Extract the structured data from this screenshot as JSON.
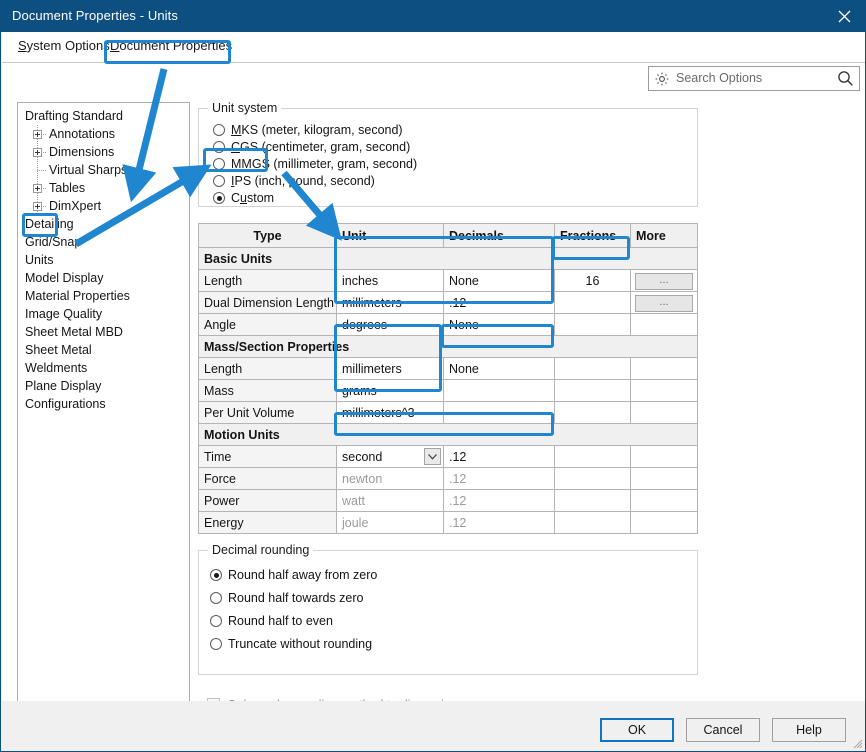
{
  "window": {
    "title": "Document Properties - Units",
    "close_icon": "close-icon",
    "titlebar_color": "#0d4f80"
  },
  "tabs": [
    {
      "label": "System Options",
      "mnemonic": "S",
      "selected": false
    },
    {
      "label": "Document Properties",
      "mnemonic": "D",
      "selected": true
    }
  ],
  "search": {
    "placeholder": "Search Options",
    "gear_icon": "gear-icon",
    "magnifier_icon": "search-icon"
  },
  "tree": {
    "items": [
      {
        "label": "Drafting Standard",
        "level": 0,
        "expandable": false,
        "selected": false
      },
      {
        "label": "Annotations",
        "level": 1,
        "expandable": true,
        "selected": false
      },
      {
        "label": "Dimensions",
        "level": 1,
        "expandable": true,
        "selected": false
      },
      {
        "label": "Virtual Sharps",
        "level": 1,
        "expandable": false,
        "selected": false
      },
      {
        "label": "Tables",
        "level": 1,
        "expandable": true,
        "selected": false
      },
      {
        "label": "DimXpert",
        "level": 1,
        "expandable": true,
        "selected": false
      },
      {
        "label": "Detailing",
        "level": 0,
        "expandable": false,
        "selected": false
      },
      {
        "label": "Grid/Snap",
        "level": 0,
        "expandable": false,
        "selected": false
      },
      {
        "label": "Units",
        "level": 0,
        "expandable": false,
        "selected": true
      },
      {
        "label": "Model Display",
        "level": 0,
        "expandable": false,
        "selected": false
      },
      {
        "label": "Material Properties",
        "level": 0,
        "expandable": false,
        "selected": false
      },
      {
        "label": "Image Quality",
        "level": 0,
        "expandable": false,
        "selected": false
      },
      {
        "label": "Sheet Metal MBD",
        "level": 0,
        "expandable": false,
        "selected": false
      },
      {
        "label": "Sheet Metal",
        "level": 0,
        "expandable": false,
        "selected": false
      },
      {
        "label": "Weldments",
        "level": 0,
        "expandable": false,
        "selected": false
      },
      {
        "label": "Plane Display",
        "level": 0,
        "expandable": false,
        "selected": false
      },
      {
        "label": "Configurations",
        "level": 0,
        "expandable": false,
        "selected": false
      }
    ]
  },
  "unit_system": {
    "legend": "Unit system",
    "options": [
      {
        "label": "MKS  (meter, kilogram, second)",
        "mnemonic": "M",
        "selected": false
      },
      {
        "label": "CGS  (centimeter, gram, second)",
        "mnemonic": "C",
        "selected": false
      },
      {
        "label": "MMGS (millimeter, gram, second)",
        "mnemonic": "G",
        "selected": false
      },
      {
        "label": "IPS  (inch, pound, second)",
        "mnemonic": "I",
        "selected": false
      },
      {
        "label": "Custom",
        "mnemonic": "u",
        "selected": true
      }
    ]
  },
  "units_table": {
    "headers": [
      "Type",
      "Unit",
      "Decimals",
      "Fractions",
      "More"
    ],
    "rows": [
      {
        "kind": "section",
        "type": "Basic Units"
      },
      {
        "kind": "data",
        "type": "Length",
        "unit": "inches",
        "decimals": "None",
        "fractions": "16",
        "more": "...",
        "dimmed": false
      },
      {
        "kind": "data",
        "type": "Dual Dimension Length",
        "unit": "millimeters",
        "decimals": ".12",
        "fractions": "",
        "more": "...",
        "dimmed": false
      },
      {
        "kind": "data",
        "type": "Angle",
        "unit": "degrees",
        "decimals": "None",
        "fractions": "",
        "more": "",
        "dimmed": false
      },
      {
        "kind": "section",
        "type": "Mass/Section Properties"
      },
      {
        "kind": "data",
        "type": "Length",
        "unit": "millimeters",
        "decimals": "None",
        "fractions": "",
        "more": "",
        "dimmed": false
      },
      {
        "kind": "data",
        "type": "Mass",
        "unit": "grams",
        "decimals": "",
        "fractions": "",
        "more": "",
        "dimmed": false
      },
      {
        "kind": "data",
        "type": "Per Unit Volume",
        "unit": "millimeters^3",
        "decimals": "",
        "fractions": "",
        "more": "",
        "dimmed": false
      },
      {
        "kind": "section",
        "type": "Motion Units"
      },
      {
        "kind": "data",
        "type": "Time",
        "unit": "second",
        "decimals": ".12",
        "fractions": "",
        "more": "",
        "dimmed": false,
        "combo": true
      },
      {
        "kind": "data",
        "type": "Force",
        "unit": "newton",
        "decimals": ".12",
        "fractions": "",
        "more": "",
        "dimmed": true
      },
      {
        "kind": "data",
        "type": "Power",
        "unit": "watt",
        "decimals": ".12",
        "fractions": "",
        "more": "",
        "dimmed": true
      },
      {
        "kind": "data",
        "type": "Energy",
        "unit": "joule",
        "decimals": ".12",
        "fractions": "",
        "more": "",
        "dimmed": true
      }
    ]
  },
  "decimal_rounding": {
    "legend": "Decimal rounding",
    "options": [
      {
        "label": "Round half away from zero",
        "selected": true
      },
      {
        "label": "Round half towards zero",
        "selected": false
      },
      {
        "label": "Round half to even",
        "selected": false
      },
      {
        "label": "Truncate without rounding",
        "selected": false
      }
    ],
    "checkbox": {
      "label": "Only apply rounding method to dimensions",
      "checked": true,
      "enabled": false
    }
  },
  "footer": {
    "ok": "OK",
    "cancel": "Cancel",
    "help": "Help"
  },
  "annotations": {
    "accent_color": "#1f86cf",
    "highlights": [
      "document-properties-tab",
      "units-tree-item",
      "custom-radio",
      "basic-units-unit-decimals-cells",
      "length-fractions-cell",
      "mass-section-unit-cells",
      "mass-section-decimals-cell",
      "time-row-cells"
    ],
    "arrows": [
      "arrow-docprops-to-detailing",
      "arrow-units-to-custom",
      "arrow-custom-to-table"
    ]
  }
}
